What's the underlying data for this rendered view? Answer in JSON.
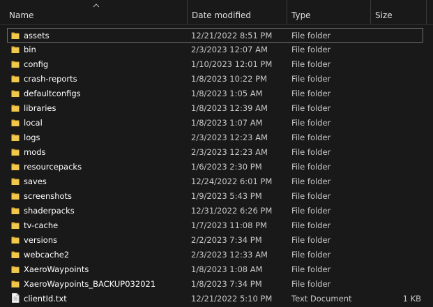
{
  "columns": {
    "name": "Name",
    "date_modified": "Date modified",
    "type": "Type",
    "size": "Size"
  },
  "sort": {
    "column": "name",
    "direction": "ascending",
    "icon": "chevron-up-icon"
  },
  "colors": {
    "background": "#191919",
    "folder": "#f2c84b",
    "folder_dark": "#dca933",
    "focus_border": "#6e6e6e"
  },
  "items": [
    {
      "name": "assets",
      "date": "12/21/2022 8:51 PM",
      "type": "File folder",
      "size": "",
      "icon": "folder-icon",
      "focused": true
    },
    {
      "name": "bin",
      "date": "2/3/2023 12:07 AM",
      "type": "File folder",
      "size": "",
      "icon": "folder-icon"
    },
    {
      "name": "config",
      "date": "1/10/2023 12:01 PM",
      "type": "File folder",
      "size": "",
      "icon": "folder-icon"
    },
    {
      "name": "crash-reports",
      "date": "1/8/2023 10:22 PM",
      "type": "File folder",
      "size": "",
      "icon": "folder-icon"
    },
    {
      "name": "defaultconfigs",
      "date": "1/8/2023 1:05 AM",
      "type": "File folder",
      "size": "",
      "icon": "folder-icon"
    },
    {
      "name": "libraries",
      "date": "1/8/2023 12:39 AM",
      "type": "File folder",
      "size": "",
      "icon": "folder-icon"
    },
    {
      "name": "local",
      "date": "1/8/2023 1:07 AM",
      "type": "File folder",
      "size": "",
      "icon": "folder-icon"
    },
    {
      "name": "logs",
      "date": "2/3/2023 12:23 AM",
      "type": "File folder",
      "size": "",
      "icon": "folder-icon"
    },
    {
      "name": "mods",
      "date": "2/3/2023 12:23 AM",
      "type": "File folder",
      "size": "",
      "icon": "folder-icon"
    },
    {
      "name": "resourcepacks",
      "date": "1/6/2023 2:30 PM",
      "type": "File folder",
      "size": "",
      "icon": "folder-icon"
    },
    {
      "name": "saves",
      "date": "12/24/2022 6:01 PM",
      "type": "File folder",
      "size": "",
      "icon": "folder-icon"
    },
    {
      "name": "screenshots",
      "date": "1/9/2023 5:43 PM",
      "type": "File folder",
      "size": "",
      "icon": "folder-icon"
    },
    {
      "name": "shaderpacks",
      "date": "12/31/2022 6:26 PM",
      "type": "File folder",
      "size": "",
      "icon": "folder-icon"
    },
    {
      "name": "tv-cache",
      "date": "1/7/2023 11:08 PM",
      "type": "File folder",
      "size": "",
      "icon": "folder-icon"
    },
    {
      "name": "versions",
      "date": "2/2/2023 7:34 PM",
      "type": "File folder",
      "size": "",
      "icon": "folder-icon"
    },
    {
      "name": "webcache2",
      "date": "2/3/2023 12:33 AM",
      "type": "File folder",
      "size": "",
      "icon": "folder-icon"
    },
    {
      "name": "XaeroWaypoints",
      "date": "1/8/2023 1:08 AM",
      "type": "File folder",
      "size": "",
      "icon": "folder-icon"
    },
    {
      "name": "XaeroWaypoints_BACKUP032021",
      "date": "1/8/2023 7:34 PM",
      "type": "File folder",
      "size": "",
      "icon": "folder-icon"
    },
    {
      "name": "clientId.txt",
      "date": "12/21/2022 5:10 PM",
      "type": "Text Document",
      "size": "1 KB",
      "icon": "text-file-icon"
    }
  ]
}
